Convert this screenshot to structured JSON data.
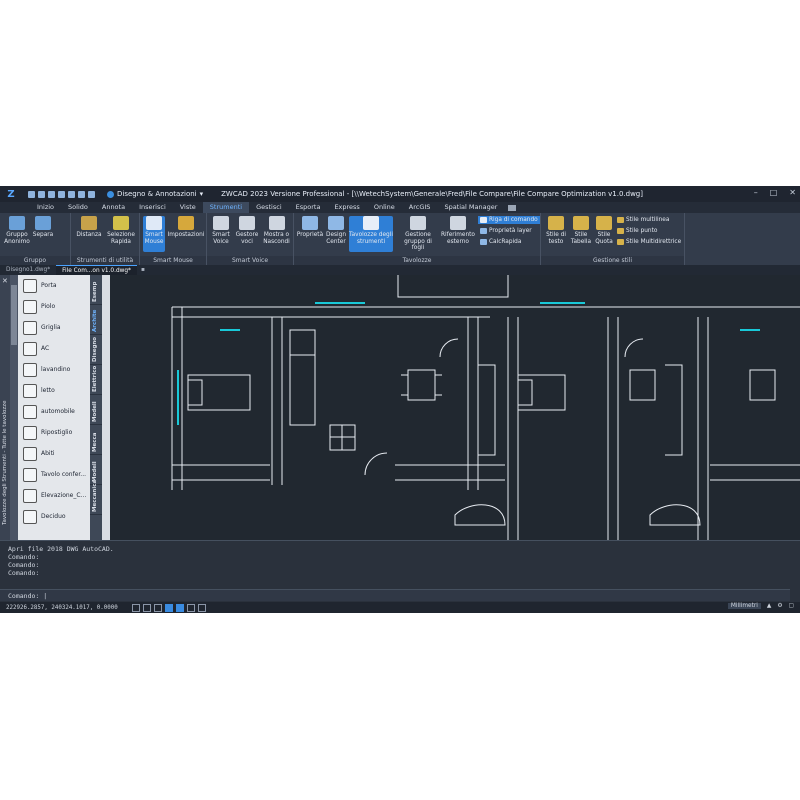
{
  "titlebar": {
    "workspace": "Disegno & Annotazioni",
    "title": "ZWCAD 2023 Versione Professional - [\\\\WetechSystem\\Generale\\Fred\\File Compare\\File Compare Optimization v1.0.dwg]",
    "controls": [
      "–",
      "□",
      "✕"
    ]
  },
  "tabs": [
    "Inizio",
    "Solido",
    "Annota",
    "Inserisci",
    "Viste",
    "Strumenti",
    "Gestisci",
    "Esporta",
    "Express",
    "Online",
    "ArcGIS",
    "Spatial Manager"
  ],
  "active_tab": "Strumenti",
  "ribbon": {
    "gruppo": {
      "label": "Gruppo",
      "buttons": [
        "Gruppo Anonimo",
        "Separa"
      ]
    },
    "utilita": {
      "label": "Strumenti di utilità",
      "buttons": [
        "Distanza",
        "Selezione Rapida"
      ]
    },
    "smart_mouse": {
      "label": "Smart Mouse",
      "buttons": [
        "Smart Mouse",
        "Impostazioni"
      ]
    },
    "smart_voice": {
      "label": "Smart Voice",
      "buttons": [
        "Smart Voice",
        "Gestore voci",
        "Mostra o Nascondi"
      ]
    },
    "tavolozze": {
      "label": "Tavolozze",
      "buttons": [
        "Proprietà",
        "Design Center",
        "Tavolozze degli strumenti",
        "Gestione gruppo di fogli",
        "Riferimento esterno"
      ],
      "small": [
        "Riga di comando",
        "Proprietà layer",
        "CalcRapida"
      ]
    },
    "stili": {
      "label": "Gestione stili",
      "buttons": [
        "Stile di testo",
        "Stile Tabella",
        "Stile Quota"
      ],
      "small": [
        "Stile multilinea",
        "Stile punto",
        "Stile Multidirettrice"
      ]
    }
  },
  "doc_tabs": [
    "Disegno1.dwg*",
    "File Com...on v1.0.dwg*"
  ],
  "palette": {
    "title": "Tavolozze degli Strumenti - Tutte le tavolozze",
    "items": [
      "Porta",
      "Piolo",
      "Griglia",
      "AC",
      "lavandino",
      "letto",
      "automobile",
      "Ripostiglio",
      "Abiti",
      "Tavolo confer...",
      "Elevazione_C...",
      "Deciduo"
    ],
    "tabs": [
      "Esemp",
      "Archite",
      "Disegno",
      "Elettrico",
      "Modell",
      "Mecca",
      "Modell",
      "Meccanica"
    ],
    "active_tab": "Archite"
  },
  "command": {
    "lines": [
      "Apri file 2018 DWG AutoCAD.",
      "Comando:",
      "Comando:",
      "Comando:"
    ],
    "prompt": "Comando: |"
  },
  "status": {
    "coords": "222926.2857, 240324.1017, 0.0000",
    "units": "Millimetri"
  },
  "colors": {
    "accent": "#2f7fd6",
    "background": "#2b3340",
    "drawing": "#212830",
    "walls": "#e8ecf2",
    "highlight": "#19c9d8"
  }
}
